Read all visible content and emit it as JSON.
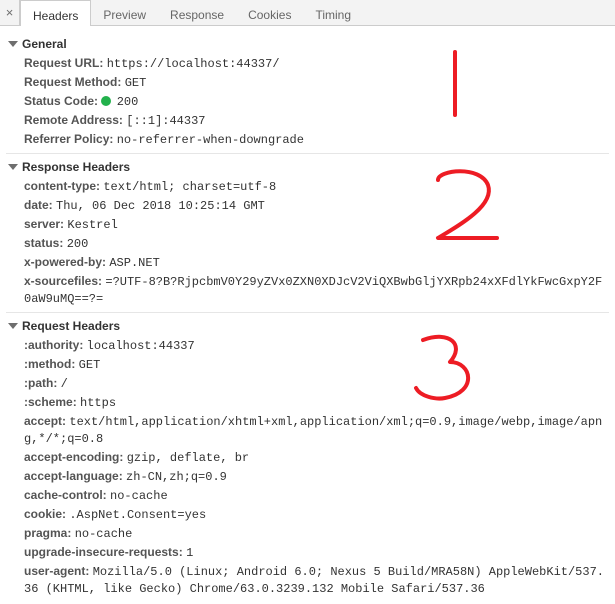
{
  "tabs": {
    "t0": "Headers",
    "t1": "Preview",
    "t2": "Response",
    "t3": "Cookies",
    "t4": "Timing"
  },
  "sections": {
    "general": {
      "title": "General",
      "rows": {
        "url_k": "Request URL:",
        "url_v": "https://localhost:44337/",
        "method_k": "Request Method:",
        "method_v": "GET",
        "status_k": "Status Code:",
        "status_v": "200",
        "remote_k": "Remote Address:",
        "remote_v": "[::1]:44337",
        "ref_k": "Referrer Policy:",
        "ref_v": "no-referrer-when-downgrade"
      }
    },
    "response": {
      "title": "Response Headers",
      "rows": {
        "ct_k": "content-type:",
        "ct_v": "text/html; charset=utf-8",
        "date_k": "date:",
        "date_v": "Thu, 06 Dec 2018 10:25:14 GMT",
        "server_k": "server:",
        "server_v": "Kestrel",
        "status_k": "status:",
        "status_v": "200",
        "xp_k": "x-powered-by:",
        "xp_v": "ASP.NET",
        "xs_k": "x-sourcefiles:",
        "xs_v": "=?UTF-8?B?RjpcbmV0Y29yZVx0ZXN0XDJcV2ViQXBwbGljYXRpb24xXFdlYkFwcGxpY2F0aW9uMQ==?="
      }
    },
    "request": {
      "title": "Request Headers",
      "rows": {
        "auth_k": ":authority:",
        "auth_v": "localhost:44337",
        "meth_k": ":method:",
        "meth_v": "GET",
        "path_k": ":path:",
        "path_v": "/",
        "scheme_k": ":scheme:",
        "scheme_v": "https",
        "accept_k": "accept:",
        "accept_v": "text/html,application/xhtml+xml,application/xml;q=0.9,image/webp,image/apng,*/*;q=0.8",
        "ae_k": "accept-encoding:",
        "ae_v": "gzip, deflate, br",
        "al_k": "accept-language:",
        "al_v": "zh-CN,zh;q=0.9",
        "cc_k": "cache-control:",
        "cc_v": "no-cache",
        "cookie_k": "cookie:",
        "cookie_v": ".AspNet.Consent=yes",
        "pragma_k": "pragma:",
        "pragma_v": "no-cache",
        "uir_k": "upgrade-insecure-requests:",
        "uir_v": "1",
        "ua_k": "user-agent:",
        "ua_v": "Mozilla/5.0 (Linux; Android 6.0; Nexus 5 Build/MRA58N) AppleWebKit/537.36 (KHTML, like Gecko) Chrome/63.0.3239.132 Mobile Safari/537.36"
      }
    }
  },
  "annotations": {
    "color": "#ed1c24",
    "labels": [
      "1",
      "2",
      "3"
    ]
  }
}
